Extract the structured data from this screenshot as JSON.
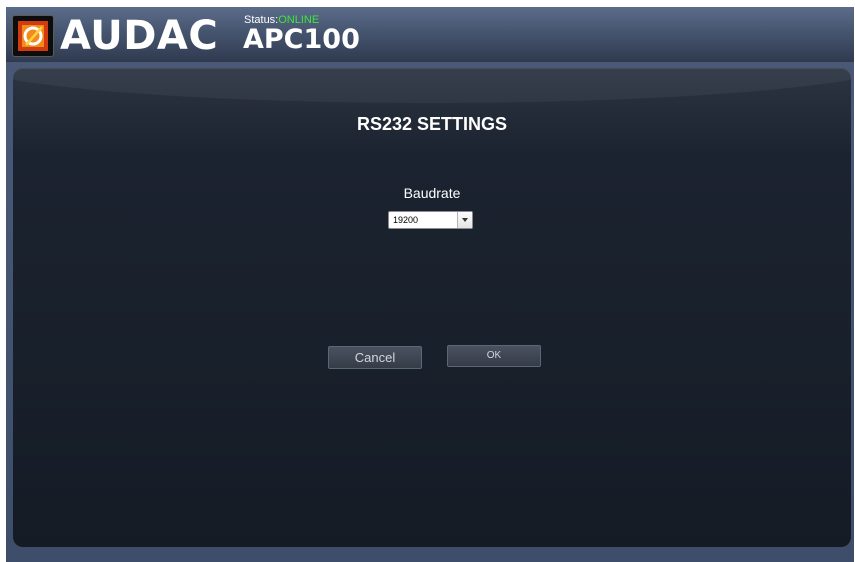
{
  "header": {
    "brand": "AUDAC",
    "status_label": "Status:",
    "status_value": "ONLINE",
    "model": "APC100",
    "logo_icon": "audac-logo-icon"
  },
  "colors": {
    "status_online": "#3ee63e",
    "panel_background": "#18202b",
    "header_background": "#46556f"
  },
  "panel": {
    "title": "RS232 SETTINGS",
    "baudrate": {
      "label": "Baudrate",
      "selected": "19200",
      "arrow_icon": "chevron-down-icon"
    },
    "buttons": {
      "cancel": "Cancel",
      "ok": "OK"
    }
  }
}
